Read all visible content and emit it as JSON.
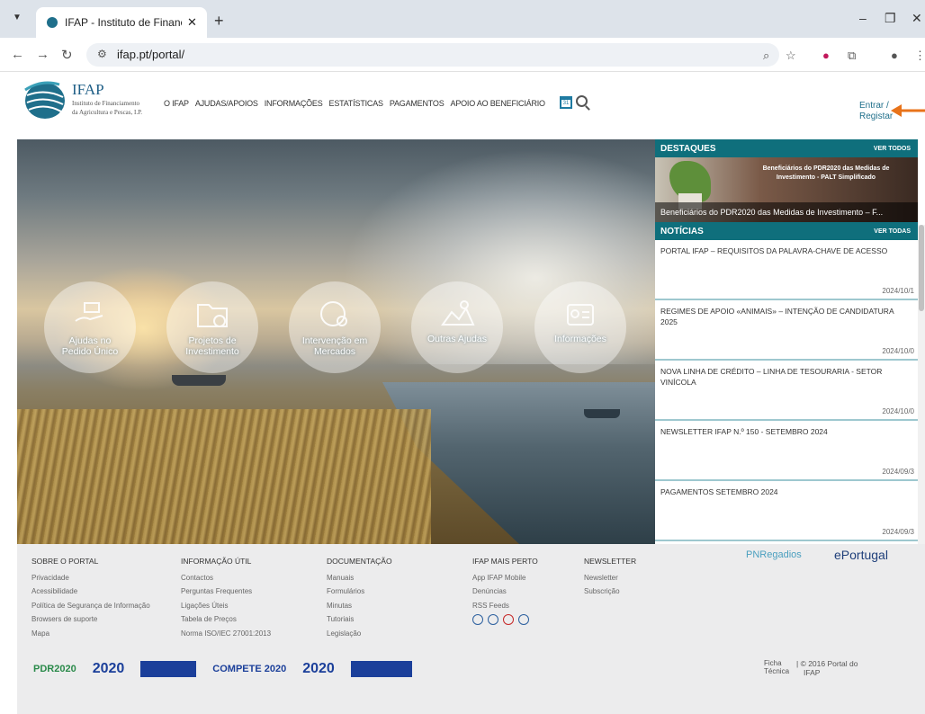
{
  "browser": {
    "tab_title": "IFAP - Instituto de Financiamento",
    "url": "ifap.pt/portal/"
  },
  "header": {
    "logo_title": "IFAP",
    "logo_sub_1": "Instituto de Financiamento",
    "logo_sub_2": "da Agricultura e Pescas, I.P.",
    "nav": [
      "O IFAP",
      "AJUDAS/APOIOS",
      "INFORMAÇÕES",
      "ESTATÍSTICAS",
      "PAGAMENTOS",
      "APOIO AO BENEFICIÁRIO"
    ],
    "login_1": "Entrar /",
    "login_2": "Registar",
    "calendar_day": "31"
  },
  "hero": {
    "circles": [
      {
        "label_1": "Ajudas no",
        "label_2": "Pedido Único",
        "icon": "hand-money-icon"
      },
      {
        "label_1": "Projetos de",
        "label_2": "Investimento",
        "icon": "folder-money-icon"
      },
      {
        "label_1": "Intervenção em",
        "label_2": "Mercados",
        "icon": "globe-person-icon"
      },
      {
        "label_1": "Outras Ajudas",
        "label_2": "",
        "icon": "landscape-icon"
      },
      {
        "label_1": "Informações",
        "label_2": "",
        "icon": "id-card-icon"
      }
    ]
  },
  "destaques": {
    "title": "DESTAQUES",
    "view_all": "VER TODOS",
    "banner_1": "Beneficiários do PDR2020 das Medidas de",
    "banner_2": "Investimento - PALT Simplificado",
    "caption": "Beneficiários do PDR2020 das Medidas de Investimento – F..."
  },
  "noticias": {
    "title": "NOTÍCIAS",
    "view_all": "VER TODAS",
    "items": [
      {
        "title": "PORTAL IFAP – REQUISITOS DA PALAVRA-CHAVE DE ACESSO",
        "date": "2024/10/1"
      },
      {
        "title": "REGIMES DE APOIO «ANIMAIS» – INTENÇÃO DE CANDIDATURA 2025",
        "date": "2024/10/0"
      },
      {
        "title": "NOVA LINHA DE CRÉDITO – LINHA DE TESOURARIA - SETOR VINÍCOLA",
        "date": "2024/10/0"
      },
      {
        "title": "NEWSLETTER IFAP N.º 150 - SETEMBRO 2024",
        "date": "2024/09/3"
      },
      {
        "title": "PAGAMENTOS SETEMBRO 2024",
        "date": "2024/09/3"
      }
    ]
  },
  "footer": {
    "columns": [
      {
        "heading": "SOBRE O PORTAL",
        "links": [
          "Privacidade",
          "Acessibilidade",
          "Política de Segurança de Informação",
          "Browsers de suporte",
          "Mapa"
        ]
      },
      {
        "heading": "INFORMAÇÃO ÚTIL",
        "links": [
          "Contactos",
          "Perguntas Frequentes",
          "Ligações Úteis",
          "Tabela de Preços",
          "Norma ISO/IEC 27001:2013"
        ]
      },
      {
        "heading": "DOCUMENTAÇÃO",
        "links": [
          "Manuais",
          "Formulários",
          "Minutas",
          "Tutoriais",
          "Legislação"
        ]
      },
      {
        "heading": "IFAP MAIS PERTO",
        "links": [
          "App IFAP Mobile",
          "Denúncias",
          "RSS Feeds"
        ]
      },
      {
        "heading": "NEWSLETTER",
        "links": [
          "Newsletter",
          "Subscrição"
        ]
      }
    ],
    "partner_1": "PNRegadios",
    "partner_2": "ePortugal",
    "logos": [
      "PDR2020",
      "2020",
      "COMPETE 2020",
      "2020"
    ],
    "ficha_1": "Ficha",
    "ficha_2": "Técnica",
    "copyright_1": "| © 2016 Portal do",
    "copyright_2": "IFAP"
  }
}
